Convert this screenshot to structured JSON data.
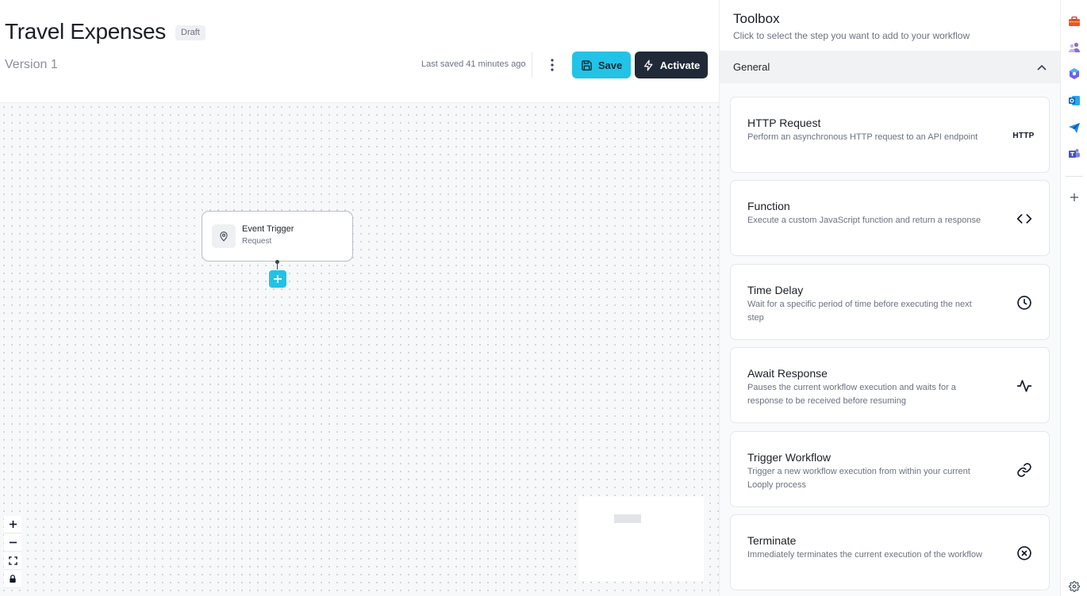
{
  "header": {
    "title": "Travel Expenses",
    "status_badge": "Draft",
    "version": "Version 1",
    "last_saved": "Last saved 41 minutes ago",
    "save_label": "Save",
    "activate_label": "Activate",
    "more_icon": "vertical-dots-icon"
  },
  "canvas": {
    "nodes": [
      {
        "title": "Event Trigger",
        "subtitle": "Request",
        "icon": "location-pin-icon"
      }
    ],
    "zoom_controls": [
      "zoom-in",
      "zoom-out",
      "fit-view",
      "lock"
    ]
  },
  "toolbox": {
    "title": "Toolbox",
    "subtitle": "Click to select the step you want to add to your workflow",
    "section": "General",
    "items": [
      {
        "title": "HTTP Request",
        "description": "Perform an asynchronous HTTP request to an API endpoint",
        "icon_label": "HTTP",
        "icon": "http-icon"
      },
      {
        "title": "Function",
        "description": "Execute a custom JavaScript function and return a response",
        "icon": "code-brackets-icon"
      },
      {
        "title": "Time Delay",
        "description": "Wait for a specific period of time before executing the next step",
        "icon": "clock-icon"
      },
      {
        "title": "Await Response",
        "description": "Pauses the current workflow execution and waits for a response to be received before resuming",
        "icon": "activity-pulse-icon"
      },
      {
        "title": "Trigger Workflow",
        "description": "Trigger a new workflow execution from within your current Looply process",
        "icon": "link-icon"
      },
      {
        "title": "Terminate",
        "description": "Immediately terminates the current execution of the workflow",
        "icon": "x-circle-icon"
      }
    ]
  },
  "rail": {
    "icons": [
      "briefcase-icon",
      "people-icon",
      "copilot-icon",
      "outlook-icon",
      "send-icon",
      "teams-icon",
      "add-icon",
      "settings-icon"
    ]
  },
  "colors": {
    "accent": "#22c3e6",
    "dark_button": "#1f2937",
    "canvas_bg": "#f7f8fa"
  }
}
